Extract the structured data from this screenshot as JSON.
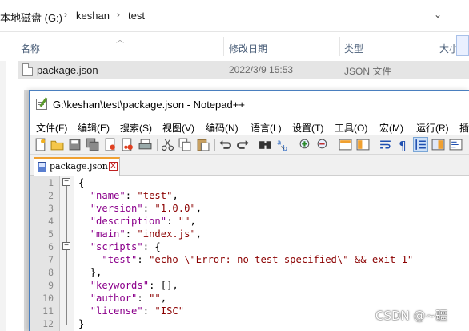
{
  "explorer": {
    "breadcrumb": [
      "本地磁盘 (G:)",
      "keshan",
      "test"
    ],
    "columns": {
      "name": "名称",
      "modified": "修改日期",
      "type": "类型",
      "size": "大小"
    },
    "file": {
      "name": "package.json",
      "modified": "2022/3/9 15:53",
      "type": "JSON 文件"
    }
  },
  "npp": {
    "title": "G:\\keshan\\test\\package.json - Notepad++",
    "menu": [
      "文件(F)",
      "编辑(E)",
      "搜索(S)",
      "视图(V)",
      "编码(N)",
      "语言(L)",
      "设置(T)",
      "工具(O)",
      "宏(M)",
      "运行(R)",
      "插"
    ],
    "tab_label": "package.json",
    "tab_close": "✕",
    "line_numbers": [
      "1",
      "2",
      "3",
      "4",
      "5",
      "6",
      "7",
      "8",
      "9",
      "10",
      "11",
      "12"
    ],
    "code": [
      [
        {
          "t": "p",
          "v": "{"
        }
      ],
      [
        {
          "t": "p",
          "v": "  "
        },
        {
          "t": "k",
          "v": "\"name\""
        },
        {
          "t": "p",
          "v": ": "
        },
        {
          "t": "s",
          "v": "\"test\""
        },
        {
          "t": "p",
          "v": ","
        }
      ],
      [
        {
          "t": "p",
          "v": "  "
        },
        {
          "t": "k",
          "v": "\"version\""
        },
        {
          "t": "p",
          "v": ": "
        },
        {
          "t": "s",
          "v": "\"1.0.0\""
        },
        {
          "t": "p",
          "v": ","
        }
      ],
      [
        {
          "t": "p",
          "v": "  "
        },
        {
          "t": "k",
          "v": "\"description\""
        },
        {
          "t": "p",
          "v": ": "
        },
        {
          "t": "s",
          "v": "\"\""
        },
        {
          "t": "p",
          "v": ","
        }
      ],
      [
        {
          "t": "p",
          "v": "  "
        },
        {
          "t": "k",
          "v": "\"main\""
        },
        {
          "t": "p",
          "v": ": "
        },
        {
          "t": "s",
          "v": "\"index.js\""
        },
        {
          "t": "p",
          "v": ","
        }
      ],
      [
        {
          "t": "p",
          "v": "  "
        },
        {
          "t": "k",
          "v": "\"scripts\""
        },
        {
          "t": "p",
          "v": ": {"
        }
      ],
      [
        {
          "t": "p",
          "v": "    "
        },
        {
          "t": "k",
          "v": "\"test\""
        },
        {
          "t": "p",
          "v": ": "
        },
        {
          "t": "s",
          "v": "\"echo \\\"Error: no test specified\\\" && exit 1\""
        }
      ],
      [
        {
          "t": "p",
          "v": "  },"
        }
      ],
      [
        {
          "t": "p",
          "v": "  "
        },
        {
          "t": "k",
          "v": "\"keywords\""
        },
        {
          "t": "p",
          "v": ": [],"
        }
      ],
      [
        {
          "t": "p",
          "v": "  "
        },
        {
          "t": "k",
          "v": "\"author\""
        },
        {
          "t": "p",
          "v": ": "
        },
        {
          "t": "s",
          "v": "\"\""
        },
        {
          "t": "p",
          "v": ","
        }
      ],
      [
        {
          "t": "p",
          "v": "  "
        },
        {
          "t": "k",
          "v": "\"license\""
        },
        {
          "t": "p",
          "v": ": "
        },
        {
          "t": "s",
          "v": "\"ISC\""
        }
      ],
      [
        {
          "t": "p",
          "v": "}"
        }
      ]
    ],
    "colors": {
      "keyword": "#8b008b",
      "string": "#8b0000",
      "tab_accent": "#f0a030"
    }
  },
  "watermark": "CSDN @~疆"
}
